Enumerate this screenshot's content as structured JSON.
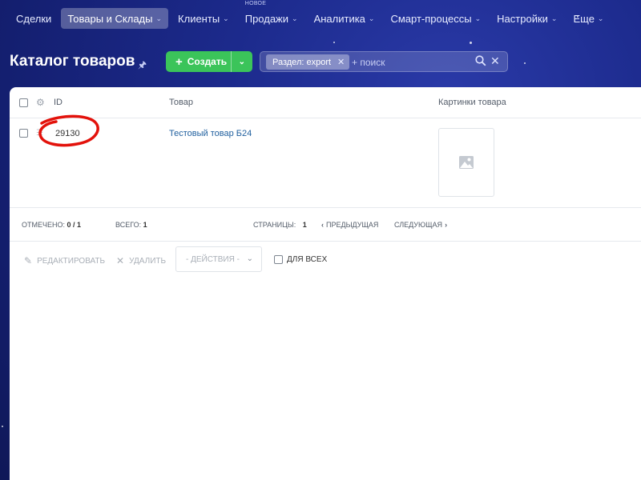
{
  "nav": {
    "items": [
      {
        "label": "Сделки",
        "dropdown": false,
        "active": false
      },
      {
        "label": "Товары и Склады",
        "dropdown": true,
        "active": true
      },
      {
        "label": "Клиенты",
        "dropdown": true,
        "active": false
      },
      {
        "label": "Продажи",
        "dropdown": true,
        "active": false,
        "badge": "НОВОЕ"
      },
      {
        "label": "Аналитика",
        "dropdown": true,
        "active": false
      },
      {
        "label": "Смарт-процессы",
        "dropdown": true,
        "active": false
      },
      {
        "label": "Настройки",
        "dropdown": true,
        "active": false
      },
      {
        "label": "Еще",
        "dropdown": true,
        "active": false
      }
    ]
  },
  "page": {
    "title": "Каталог товаров",
    "create_label": "Создать"
  },
  "filter": {
    "chip_label": "Раздел: export",
    "search_placeholder": "+ поиск"
  },
  "table": {
    "columns": {
      "id": "ID",
      "product": "Товар",
      "image": "Картинки товара"
    },
    "rows": [
      {
        "id": "29130",
        "product": "Тестовый товар Б24",
        "checked": false
      }
    ]
  },
  "footer": {
    "selected_label": "ОТМЕЧЕНО:",
    "selected_value": "0 / 1",
    "total_label": "ВСЕГО:",
    "total_value": "1",
    "pages_label": "СТРАНИЦЫ:",
    "pages_value": "1",
    "prev_label": "ПРЕДЫДУЩАЯ",
    "next_label": "СЛЕДУЮЩАЯ"
  },
  "actions": {
    "edit_label": "РЕДАКТИРОВАТЬ",
    "delete_label": "УДАЛИТЬ",
    "select_label": "- ДЕЙСТВИЯ -",
    "for_all_label": "ДЛЯ ВСЕХ"
  },
  "colors": {
    "accent_green": "#3bc45a",
    "link_blue": "#1f5f9e",
    "annotation_red": "#e3120b",
    "background_blue": "#1c2a8c"
  },
  "icons": {
    "pin": "pin-icon",
    "plus": "plus-icon",
    "search": "search-icon",
    "clear": "close-icon",
    "gear": "gear-icon",
    "drag": "drag-handle-icon",
    "image_placeholder": "image-icon",
    "edit": "pencil-icon",
    "delete": "close-icon"
  }
}
